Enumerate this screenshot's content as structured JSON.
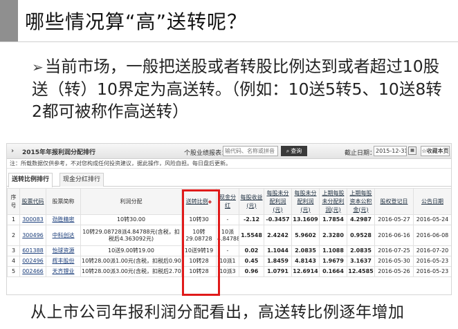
{
  "slide": {
    "title": "哪些情况算“高”送转呢？",
    "bullet_arrow": "➢",
    "bullet_text": "当前市场，一般把送股或者转股比例达到或者超过10股送（转）10界定为高送转。（例如：10送5转5、10送8转2都可被称作高送转）",
    "footer": "从上市公司年报利润分配看出，高送转比例逐年增加"
  },
  "screenshot": {
    "chevron": "›",
    "title": "2015年年报利润分配排行",
    "search_label": "个股业绩报表：",
    "search_placeholder": "输代码、名称或拼音",
    "search_button": "查询",
    "search_icon": "magnifier-icon",
    "date_label": "截止日期：",
    "date_value": "2015-12-31",
    "calendar_icon": "calendar-icon",
    "favorite_button": "收藏本页",
    "notice": "注：所载数据仅供参考，不对您构成任何投资建议，据此操作，风险自担。每日盘后更新。",
    "tabs": [
      {
        "label": "送转比例排行",
        "active": true
      },
      {
        "label": "现金分红排行",
        "active": false
      }
    ],
    "columns": [
      "序号",
      "股票代码",
      "股票简称",
      "利润分配",
      "送转比例",
      "现金分红",
      "每股收益(元)",
      "每股未分配利润(元)",
      "每股未分配利润(元)",
      "上期每股未分配利润(元)",
      "上期每股资本公积金(元)",
      "股权登记日",
      "公告日期"
    ],
    "rows": [
      {
        "no": "1",
        "code": "300083",
        "name": "劲胜精密",
        "plan": "10转30.00",
        "ratio": "10转30",
        "cash": "-",
        "eps": "-2.12",
        "c7": "-0.3457",
        "c8": "13.1609",
        "c9": "1.7854",
        "c10": "4.2987",
        "record": "2016-05-27",
        "announce": "2016-05-24"
      },
      {
        "no": "2",
        "code": "300496",
        "name": "中科创达",
        "plan": "10转29.08728派4.84788元(含税，扣税后4.363092元)",
        "ratio": "10转29.08728",
        "cash": "10派4.84788",
        "eps": "1.5548",
        "c7": "2.4242",
        "c8": "5.9602",
        "c9": "2.3280",
        "c10": "0.9528",
        "record": "2016-06-16",
        "announce": "2016-06-08"
      },
      {
        "no": "3",
        "code": "601388",
        "name": "怡球资源",
        "plan": "10送9.00转19.00",
        "ratio": "10送9转19",
        "cash": "-",
        "eps": "0.02",
        "c7": "1.1044",
        "c8": "2.0835",
        "c9": "1.1088",
        "c10": "2.0835",
        "record": "2016-07-25",
        "announce": "2016-07-20"
      },
      {
        "no": "4",
        "code": "002496",
        "name": "辉丰股份",
        "plan": "10转28.00派1.00元(含税，扣税后0.90元)",
        "ratio": "10转28",
        "cash": "10派1",
        "eps": "0.45",
        "c7": "1.8459",
        "c8": "4.8143",
        "c9": "1.9679",
        "c10": "3.1637",
        "record": "2016-05-30",
        "announce": "2016-05-23"
      },
      {
        "no": "5",
        "code": "002466",
        "name": "天齐锂业",
        "plan": "10转28.00派3.00元(含税，扣税后2.70元)",
        "ratio": "10转28",
        "cash": "10派3",
        "eps": "0.96",
        "c7": "1.0791",
        "c8": "12.6914",
        "c9": "0.1664",
        "c10": "12.4585",
        "record": "2016-05-26",
        "announce": "2016-05-23"
      }
    ]
  },
  "colors": {
    "accent_bar": "#8f8f8f",
    "highlight_box": "#e01a1a",
    "link": "#1a3d7a"
  }
}
